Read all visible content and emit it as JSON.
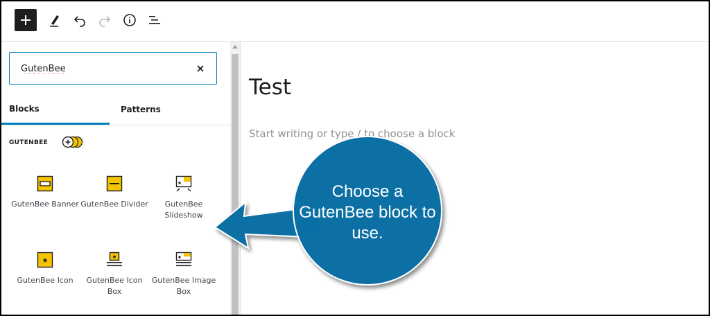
{
  "toolbar": {
    "add_icon": "plus-icon",
    "tools": [
      "pencil-icon",
      "undo-icon",
      "redo-icon",
      "info-icon",
      "list-view-icon"
    ]
  },
  "inserter": {
    "search": {
      "value": "GutenBee",
      "clear_icon": "close-icon"
    },
    "tabs": [
      {
        "label": "Blocks",
        "active": true
      },
      {
        "label": "Patterns",
        "active": false
      }
    ],
    "category": {
      "title": "GUTENBEE",
      "logo_icon": "gutenbee-logo-icon"
    },
    "blocks": [
      {
        "label": "GutenBee Banner",
        "icon": "banner-icon"
      },
      {
        "label": "GutenBee Divider",
        "icon": "divider-icon"
      },
      {
        "label": "GutenBee Slideshow",
        "icon": "slideshow-icon"
      },
      {
        "label": "GutenBee Icon",
        "icon": "star-box-icon"
      },
      {
        "label": "GutenBee Icon Box",
        "icon": "icon-box-icon"
      },
      {
        "label": "GutenBee Image Box",
        "icon": "image-box-icon"
      }
    ]
  },
  "editor": {
    "post_title": "Test",
    "placeholder": "Start writing or type / to choose a block"
  },
  "callout": {
    "text": "Choose a GutenBee block to use.",
    "color": "#0a6fa5"
  },
  "colors": {
    "accent": "#007cba",
    "gutenbee_yellow": "#f5c400"
  }
}
